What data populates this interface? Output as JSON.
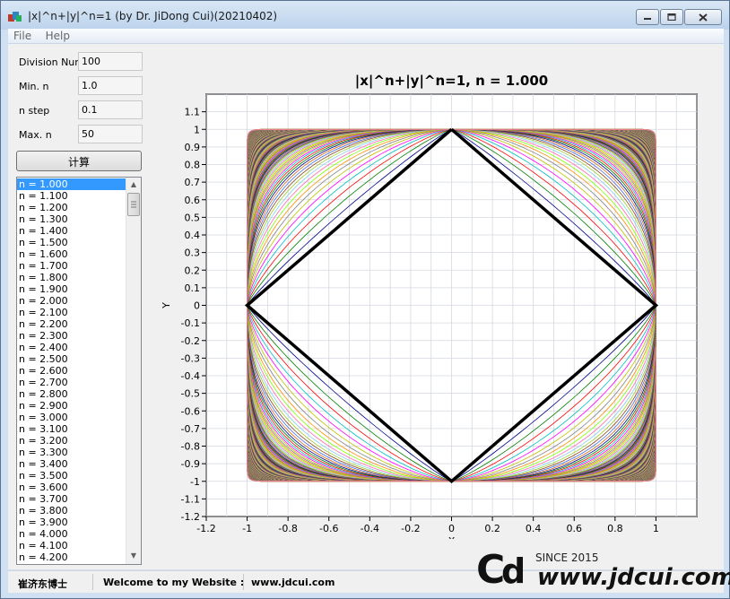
{
  "window": {
    "title": "|x|^n+|y|^n=1 (by Dr. JiDong Cui)(20210402)",
    "minimize_icon": "minimize-icon",
    "maximize_icon": "maximize-icon",
    "close_icon": "close-icon"
  },
  "menu": [
    "File",
    "Help"
  ],
  "params": {
    "division_label": "Division Num",
    "division_value": "100",
    "min_label": "Min. n",
    "min_value": "1.0",
    "step_label": "n step",
    "step_value": "0.1",
    "max_label": "Max. n",
    "max_value": "50",
    "calc_label": "计算"
  },
  "list": {
    "selected_index": 0,
    "items": [
      "n = 1.000",
      "n = 1.100",
      "n = 1.200",
      "n = 1.300",
      "n = 1.400",
      "n = 1.500",
      "n = 1.600",
      "n = 1.700",
      "n = 1.800",
      "n = 1.900",
      "n = 2.000",
      "n = 2.100",
      "n = 2.200",
      "n = 2.300",
      "n = 2.400",
      "n = 2.500",
      "n = 2.600",
      "n = 2.700",
      "n = 2.800",
      "n = 2.900",
      "n = 3.000",
      "n = 3.100",
      "n = 3.200",
      "n = 3.300",
      "n = 3.400",
      "n = 3.500",
      "n = 3.600",
      "n = 3.700",
      "n = 3.800",
      "n = 3.900",
      "n = 4.000",
      "n = 4.100",
      "n = 4.200"
    ]
  },
  "chart_data": {
    "type": "line",
    "title": "|x|^n+|y|^n=1, n = 1.000",
    "xlabel": "X",
    "ylabel": "Y",
    "xlim": [
      -1.2,
      1.2
    ],
    "ylim": [
      -1.2,
      1.2
    ],
    "xticks": [
      "-1.2",
      "-1",
      "-0.8",
      "-0.6",
      "-0.4",
      "-0.2",
      "0",
      "0.2",
      "0.4",
      "0.6",
      "0.8",
      "1"
    ],
    "yticks": [
      "1.1",
      "1",
      "0.9",
      "0.8",
      "0.7",
      "0.6",
      "0.5",
      "0.4",
      "0.3",
      "0.2",
      "0.1",
      "0",
      "-0.1",
      "-0.2",
      "-0.3",
      "-0.4",
      "-0.5",
      "-0.6",
      "-0.7",
      "-0.8",
      "-0.9",
      "-1",
      "-1.1",
      "-1.2"
    ],
    "grid": true,
    "n_min": 1.0,
    "n_step": 0.1,
    "n_max": 50,
    "highlighted_n": 1.0,
    "highlight_color": "#000000",
    "curve_colors": [
      "#00008b",
      "#008000",
      "#ff0000",
      "#00bfbf",
      "#ff00ff",
      "#bfbf00",
      "#808080",
      "#ff8c00",
      "#7fff00",
      "#ff69b4",
      "#87ceeb",
      "#9acd32",
      "#8b4513",
      "#4169e1",
      "#d2691e"
    ]
  },
  "status": {
    "author": "崔济东博士",
    "welcome": "Welcome to my Website :",
    "website": "www.jdcui.com"
  },
  "watermark": {
    "since": "SINCE 2015",
    "url": "www.jdcui.com"
  }
}
